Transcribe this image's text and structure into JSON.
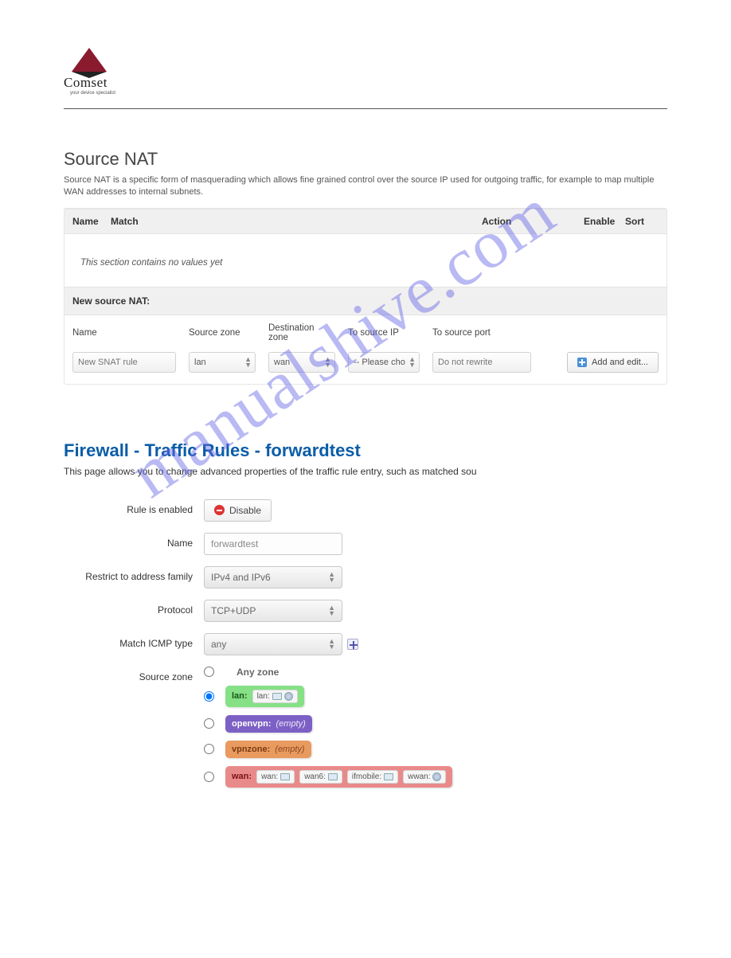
{
  "brand": {
    "name": "Comset",
    "tagline": "your device specialist"
  },
  "watermark": "manualshive.com",
  "snat": {
    "title": "Source NAT",
    "desc": "Source NAT is a specific form of masquerading which allows fine grained control over the source IP used for outgoing traffic, for example to map multiple WAN addresses to internal subnets.",
    "columns": {
      "name": "Name",
      "match": "Match",
      "action": "Action",
      "enable": "Enable",
      "sort": "Sort"
    },
    "empty": "This section contains no values yet",
    "new_heading": "New source NAT:",
    "labels": {
      "name": "Name",
      "source_zone": "Source zone",
      "dest_zone": "Destination zone",
      "to_source_ip": "To source IP",
      "to_source_port": "To source port"
    },
    "inputs": {
      "name_placeholder": "New SNAT rule",
      "source_zone_value": "lan",
      "dest_zone_value": "wan",
      "to_ip_value": "-- Please cho",
      "to_port_placeholder": "Do not rewrite"
    },
    "add_button": "Add and edit..."
  },
  "fw": {
    "title": "Firewall - Traffic Rules - forwardtest",
    "desc": "This page allows you to change advanced properties of the traffic rule entry, such as matched sou",
    "labels": {
      "enabled": "Rule is enabled",
      "name": "Name",
      "family": "Restrict to address family",
      "protocol": "Protocol",
      "icmp": "Match ICMP type",
      "source_zone": "Source zone"
    },
    "values": {
      "disable_btn": "Disable",
      "name": "forwardtest",
      "family": "IPv4 and IPv6",
      "protocol": "TCP+UDP",
      "icmp": "any"
    },
    "zones": {
      "any": "Any zone",
      "lan": {
        "label": "lan:",
        "ifaces": [
          "lan:"
        ],
        "selected": true
      },
      "openvpn": {
        "label": "openvpn:",
        "empty": "(empty)"
      },
      "vpnzone": {
        "label": "vpnzone:",
        "empty": "(empty)"
      },
      "wan": {
        "label": "wan:",
        "ifaces": [
          "wan:",
          "wan6:",
          "ifmobile:",
          "wwan:"
        ]
      }
    }
  }
}
